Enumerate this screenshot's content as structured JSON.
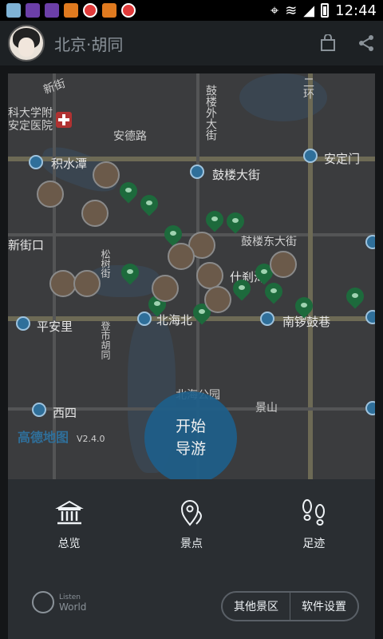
{
  "status_bar": {
    "time": "12:44"
  },
  "app_bar": {
    "title": "北京·胡同"
  },
  "map": {
    "labels": {
      "hospital": "科大学附\n安定医院",
      "xinjiekou": "新街口",
      "andelu": "安德路",
      "gulou_wai": "鼓楼外大街",
      "jishuitan": "积水潭",
      "gulou_dajie": "鼓楼大街",
      "andingmen": "安定门",
      "gulou_dong": "鼓楼东大街",
      "shichahai": "什刹海",
      "beihaibei": "北海北",
      "nanluoguxiang": "南锣鼓巷",
      "pinganli": "平安里",
      "xisi": "西四",
      "beihaigongyuan": "北海公园",
      "jingshan": "景山",
      "xinjie": "新街",
      "erhuan": "二环",
      "songshu": "松树街",
      "denghuishi": "登市胡同"
    },
    "amap_logo": "高德地图",
    "version": "V2.4.0"
  },
  "start_button": {
    "line1": "开始",
    "line2": "导游"
  },
  "nav": [
    {
      "label": "总览",
      "icon": "museum-icon"
    },
    {
      "label": "景点",
      "icon": "map-pin-icon"
    },
    {
      "label": "足迹",
      "icon": "footprints-icon"
    }
  ],
  "logo": {
    "line1": "Listen",
    "line2": "World"
  },
  "pill_buttons": {
    "other": "其他景区",
    "settings": "软件设置"
  }
}
